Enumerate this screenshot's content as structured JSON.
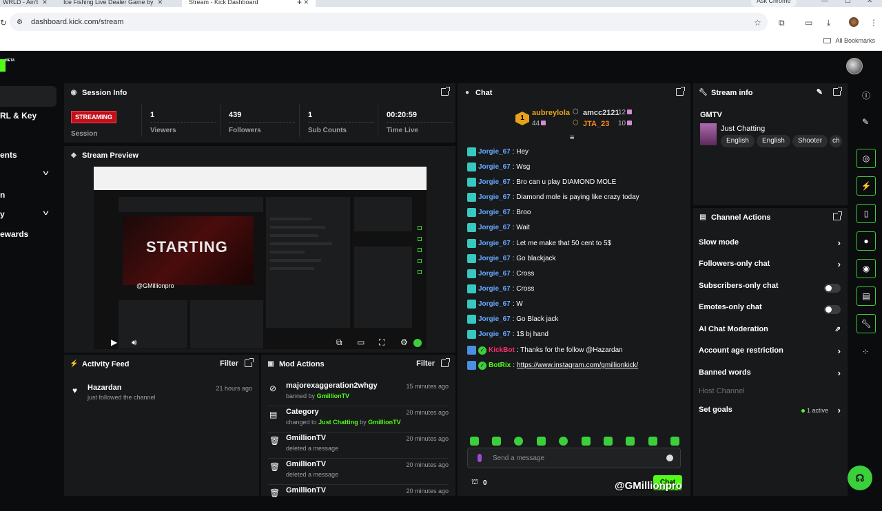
{
  "browser": {
    "tabs": [
      {
        "label": "WRLD - Ain't"
      },
      {
        "label": "Ice Fishing Live Dealer Game by"
      },
      {
        "label": "Stream - Kick Dashboard"
      }
    ],
    "new_tab": "+",
    "ask_chrome": "Ask Chrome",
    "url": "dashboard.kick.com/stream",
    "all_bookmarks": "All Bookmarks"
  },
  "topbar": {
    "beta": "BETA"
  },
  "leftnav": {
    "items": [
      {
        "label": "RL & Key"
      },
      {
        "label": "ents"
      },
      {
        "label": "n"
      },
      {
        "label": "y"
      },
      {
        "label": "ewards"
      }
    ]
  },
  "session_info": {
    "title": "Session Info",
    "badge": "STREAMING",
    "badge_label": "Session",
    "stats": [
      {
        "value": "1",
        "label": "Viewers"
      },
      {
        "value": "439",
        "label": "Followers"
      },
      {
        "value": "1",
        "label": "Sub Counts"
      },
      {
        "value": "00:20:59",
        "label": "Time Live"
      }
    ]
  },
  "stream_preview": {
    "title": "Stream Preview",
    "overlay_text": "STARTING",
    "handle": "@GMillionpro"
  },
  "activity_feed": {
    "title": "Activity Feed",
    "filter": "Filter",
    "items": [
      {
        "name": "Hazardan",
        "sub": "just followed the channel",
        "time": "21 hours ago"
      }
    ]
  },
  "mod_actions": {
    "title": "Mod Actions",
    "filter": "Filter",
    "items": [
      {
        "title": "majorexaggeration2whgy",
        "sub_prefix": "banned by",
        "sub_user": "GmillionTV",
        "sub_mid": "",
        "sub_user2": "",
        "time": "15 minutes ago",
        "icon": "ban-icon"
      },
      {
        "title": "Category",
        "sub_prefix": "changed to",
        "sub_user": "Just Chatting",
        "sub_mid": "by",
        "sub_user2": "GmillionTV",
        "time": "20 minutes ago",
        "icon": "category-icon"
      },
      {
        "title": "GmillionTV",
        "sub_prefix": "deleted a message",
        "sub_user": "",
        "sub_mid": "",
        "sub_user2": "",
        "time": "20 minutes ago",
        "icon": "trash-icon"
      },
      {
        "title": "GmillionTV",
        "sub_prefix": "deleted a message",
        "sub_user": "",
        "sub_mid": "",
        "sub_user2": "",
        "time": "20 minutes ago",
        "icon": "trash-icon"
      },
      {
        "title": "GmillionTV",
        "sub_prefix": "",
        "sub_user": "",
        "sub_mid": "",
        "sub_user2": "",
        "time": "20 minutes ago",
        "icon": "trash-icon"
      }
    ]
  },
  "chat": {
    "title": "Chat",
    "top_gifters": [
      {
        "rank": "1",
        "name": "aubreylola",
        "count": "44"
      },
      {
        "name": "amcc2121",
        "count": "12"
      },
      {
        "name": "JTA_23",
        "count": "10"
      }
    ],
    "messages": [
      {
        "user": "Jorgie_67",
        "text": ": Hey"
      },
      {
        "user": "Jorgie_67",
        "text": ": Wsg"
      },
      {
        "user": "Jorgie_67",
        "text": ": Bro can u play DIAMOND MOLE"
      },
      {
        "user": "Jorgie_67",
        "text": ": Diamond mole is paying like crazy today"
      },
      {
        "user": "Jorgie_67",
        "text": ": Broo"
      },
      {
        "user": "Jorgie_67",
        "text": ": Wait"
      },
      {
        "user": "Jorgie_67",
        "text": ": Let me make that 50 cent to 5$"
      },
      {
        "user": "Jorgie_67",
        "text": ": Go blackjack"
      },
      {
        "user": "Jorgie_67",
        "text": ": Cross"
      },
      {
        "user": "Jorgie_67",
        "text": ": Cross"
      },
      {
        "user": "Jorgie_67",
        "text": ": W"
      },
      {
        "user": "Jorgie_67",
        "text": ": Go Black jack"
      },
      {
        "user": "Jorgie_67",
        "text": ": 1$ bj hand"
      }
    ],
    "bot_messages": [
      {
        "user": "KickBot",
        "text": ": Thanks for the follow @Hazardan"
      },
      {
        "user": "BotRix",
        "text": ": ",
        "link": "https://www.instagram.com/gmillionkick/"
      }
    ],
    "placeholder": "Send a message",
    "points": "0",
    "send_label": "Chat"
  },
  "stream_info": {
    "title": "Stream info",
    "stream_title": "GMTV",
    "category": "Just Chatting",
    "tags": [
      "English",
      "English",
      "Shooter",
      "ch"
    ]
  },
  "channel_actions": {
    "title": "Channel Actions",
    "items": [
      {
        "label": "Slow mode"
      },
      {
        "label": "Followers-only chat"
      },
      {
        "label": "Subscribers-only chat"
      },
      {
        "label": "Emotes-only chat"
      },
      {
        "label": "AI Chat Moderation"
      },
      {
        "label": "Account age restriction"
      },
      {
        "label": "Banned words"
      },
      {
        "label": "Host Channel"
      },
      {
        "label": "Set goals",
        "status": "1 active"
      }
    ]
  },
  "watermark": "@GMillionpro",
  "colors": {
    "brand": "#53fc18",
    "panel": "#17191b",
    "streaming": "#c20f1a"
  }
}
